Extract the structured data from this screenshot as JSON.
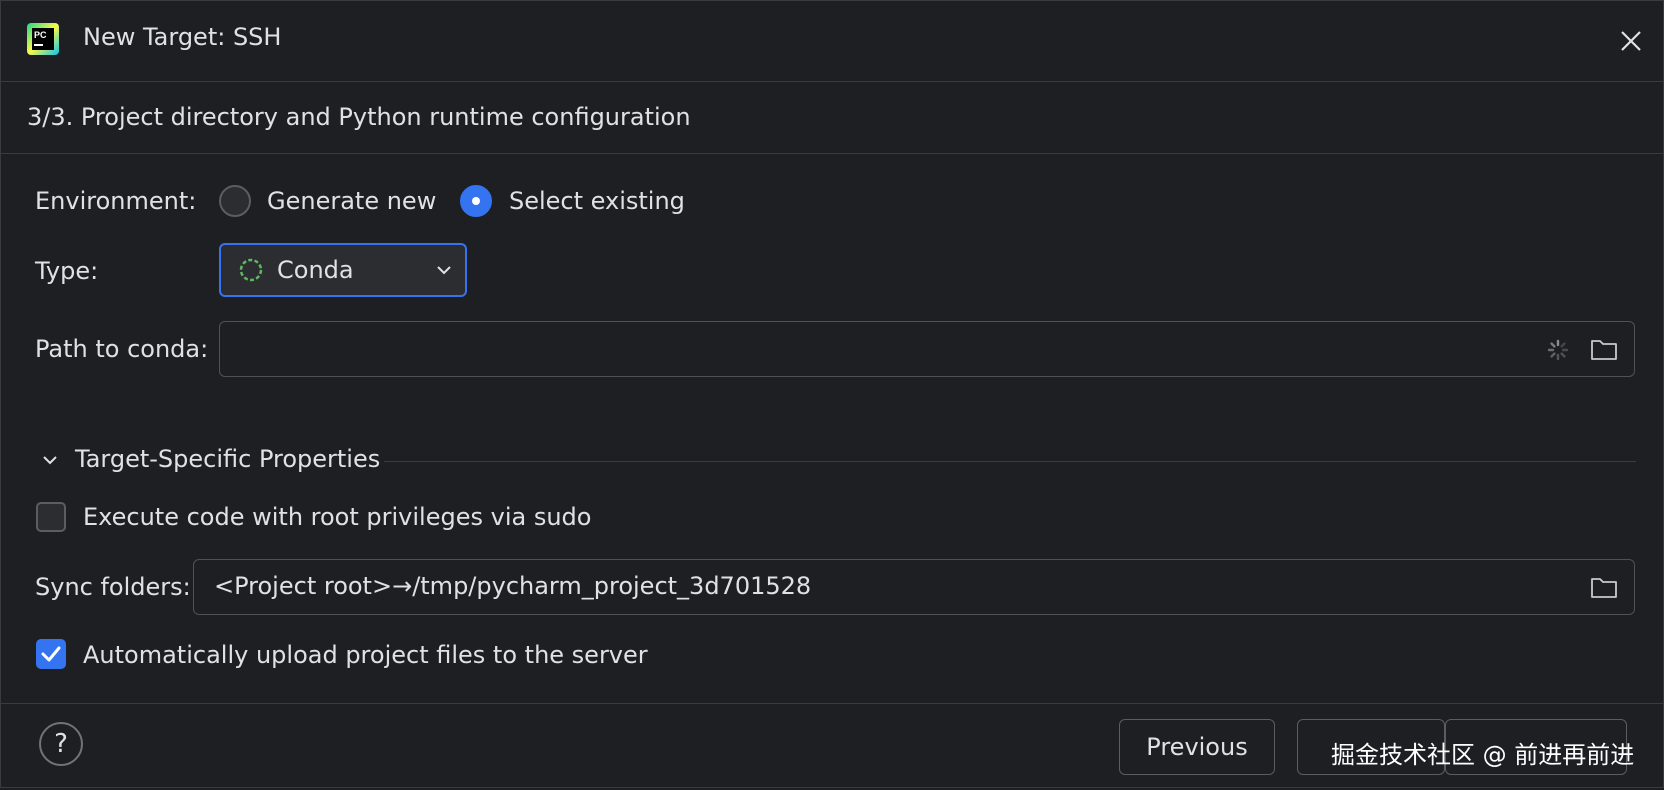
{
  "window": {
    "title": "New Target: SSH",
    "app_icon_text": "PC"
  },
  "step": {
    "title": "3/3. Project directory and Python runtime configuration"
  },
  "environment": {
    "label": "Environment:",
    "options": [
      {
        "label": "Generate new",
        "selected": false
      },
      {
        "label": "Select existing",
        "selected": true
      }
    ]
  },
  "type": {
    "label": "Type:",
    "value": "Conda",
    "icon": "conda-spinner-icon"
  },
  "conda_path": {
    "label": "Path to conda:",
    "value": ""
  },
  "target_specific": {
    "section_title": "Target-Specific Properties",
    "sudo": {
      "label": "Execute code with root privileges via sudo",
      "checked": false
    },
    "sync_folders": {
      "label": "Sync folders:",
      "value": "<Project root>→/tmp/pycharm_project_3d701528"
    },
    "auto_upload": {
      "label": "Automatically upload project files to the server",
      "checked": true
    }
  },
  "footer": {
    "help_label": "?",
    "previous_label": "Previous",
    "watermark": "掘金技术社区 @ 前进再前进"
  },
  "colors": {
    "accent": "#3574f0",
    "background": "#1e1f22",
    "conda_green": "#5fb85f"
  }
}
